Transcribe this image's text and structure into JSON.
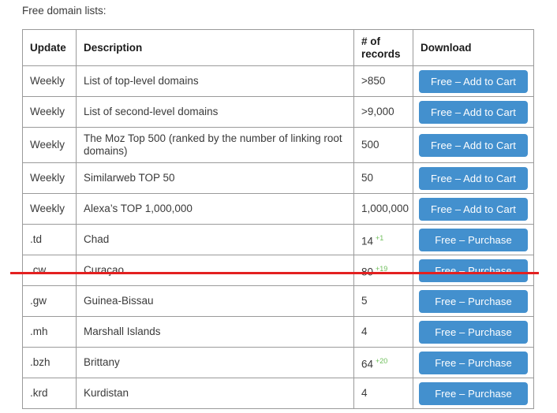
{
  "intro": {
    "text": "Free domain lists:"
  },
  "table": {
    "headers": {
      "update": "Update",
      "description": "Description",
      "records": "# of records",
      "download": "Download"
    },
    "rows": [
      {
        "update": "Weekly",
        "description": "List of top-level domains",
        "records": "&gt;850",
        "records_delta": "",
        "download": "Free – Add to Cart"
      },
      {
        "update": "Weekly",
        "description": "List of second-level domains",
        "records": "&gt;9,000",
        "records_delta": "",
        "download": "Free – Add to Cart"
      },
      {
        "update": "Weekly",
        "description": "The Moz Top 500 (ranked by the number of linking root domains)",
        "records": "500",
        "records_delta": "",
        "download": "Free – Add to Cart"
      },
      {
        "update": "Weekly",
        "description": "Similarweb TOP 50",
        "records": "50",
        "records_delta": "",
        "download": "Free – Add to Cart"
      },
      {
        "update": "Weekly",
        "description": "Alexa’s TOP 1,000,000",
        "records": "1,000,000",
        "records_delta": "",
        "download": "Free – Add to Cart"
      },
      {
        "update": ".td",
        "description": "Chad",
        "records": "14",
        "records_delta": "+1",
        "download": "Free – Purchase"
      },
      {
        "update": ".cw",
        "description": "Curaçao",
        "records": "80",
        "records_delta": "+19",
        "download": "Free – Purchase"
      },
      {
        "update": ".gw",
        "description": "Guinea-Bissau",
        "records": "5",
        "records_delta": "",
        "download": "Free – Purchase"
      },
      {
        "update": ".mh",
        "description": "Marshall Islands",
        "records": "4",
        "records_delta": "",
        "download": "Free – Purchase"
      },
      {
        "update": ".bzh",
        "description": "Brittany",
        "records": "64",
        "records_delta": "+20",
        "download": "Free – Purchase"
      },
      {
        "update": ".krd",
        "description": "Kurdistan",
        "records": "4",
        "records_delta": "",
        "download": "Free – Purchase"
      }
    ]
  },
  "annotation": {
    "red_line_color": "#e32020"
  },
  "colors": {
    "button_blue": "#4390ce",
    "delta_green": "#6dbe5a",
    "border_gray": "#9a9a9a",
    "text": "#3a3a3a"
  }
}
